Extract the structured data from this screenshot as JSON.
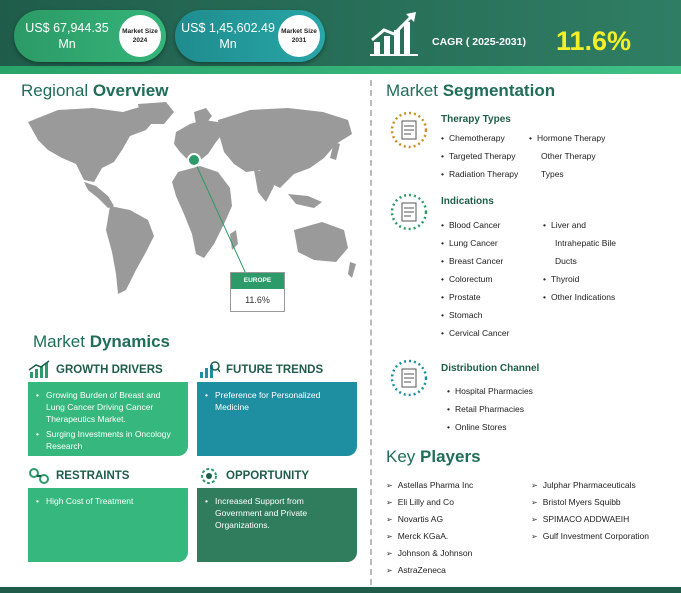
{
  "header": {
    "size_2024_value": "US$ 67,944.35 Mn",
    "size_2024_label": "Market Size 2024",
    "size_2031_value": "US$ 1,45,602.49 Mn",
    "size_2031_label": "Market Size 2031",
    "cagr_label": "CAGR ( 2025-2031)",
    "cagr_value": "11.6%"
  },
  "regional": {
    "title_a": "Regional ",
    "title_b": "Overview",
    "region_name": "EUROPE",
    "region_value": "11.6%"
  },
  "dynamics": {
    "title_a": "Market ",
    "title_b": "Dynamics",
    "growth_drivers": {
      "label": "GROWTH DRIVERS",
      "items": [
        "Growing Burden of Breast and Lung Cancer Driving Cancer Therapeutics Market.",
        "Surging Investments in Oncology Research"
      ]
    },
    "future_trends": {
      "label": "FUTURE TRENDS",
      "items": [
        "Preference for Personalized Medicine"
      ]
    },
    "restraints": {
      "label": "RESTRAINTS",
      "items": [
        "High Cost of Treatment"
      ]
    },
    "opportunity": {
      "label": "OPPORTUNITY",
      "items": [
        "Increased Support from Government and Private Organizations."
      ]
    }
  },
  "segmentation": {
    "title_a": "Market ",
    "title_b": "Segmentation",
    "therapy": {
      "title": "Therapy Types",
      "col1": [
        "Chemotherapy",
        "Targeted Therapy",
        "Radiation Therapy"
      ],
      "col2": [
        "Hormone Therapy",
        "Other Therapy",
        "Types"
      ]
    },
    "indications": {
      "title": "Indications",
      "col1": [
        "Blood Cancer",
        "Lung Cancer",
        "Breast Cancer",
        "Colorectum",
        "Prostate",
        "Stomach",
        "Cervical Cancer"
      ],
      "col2": [
        "Liver and",
        "Intrahepatic Bile",
        "Ducts",
        "Thyroid",
        "Other Indications"
      ]
    },
    "distribution": {
      "title": "Distribution Channel",
      "items": [
        "Hospital Pharmacies",
        "Retail Pharmacies",
        "Online Stores"
      ]
    }
  },
  "key_players": {
    "title_a": "Key ",
    "title_b": "Players",
    "col1": [
      "Astellas Pharma Inc",
      "Eli Lilly and Co",
      "Novartis AG",
      "Merck KGaA.",
      "Johnson & Johnson",
      "AstraZeneca"
    ],
    "col2": [
      "Julphar Pharmaceuticals",
      "Bristol Myers Squibb",
      "SPIMACO ADDWAEIH",
      "Gulf Investment Corporation"
    ]
  },
  "colors": {
    "brand_dark": "#1f5d4a",
    "brand_green": "#36b77d",
    "brand_teal": "#1e8ea1",
    "accent_yellow": "#f3ef2a"
  },
  "icons": [
    "growth-chart-icon",
    "therapy-icon",
    "indications-icon",
    "distribution-icon",
    "growth-drivers-icon",
    "future-trends-icon",
    "restraints-icon",
    "opportunity-icon",
    "location-pin-icon",
    "arrow-bullet-icon"
  ]
}
